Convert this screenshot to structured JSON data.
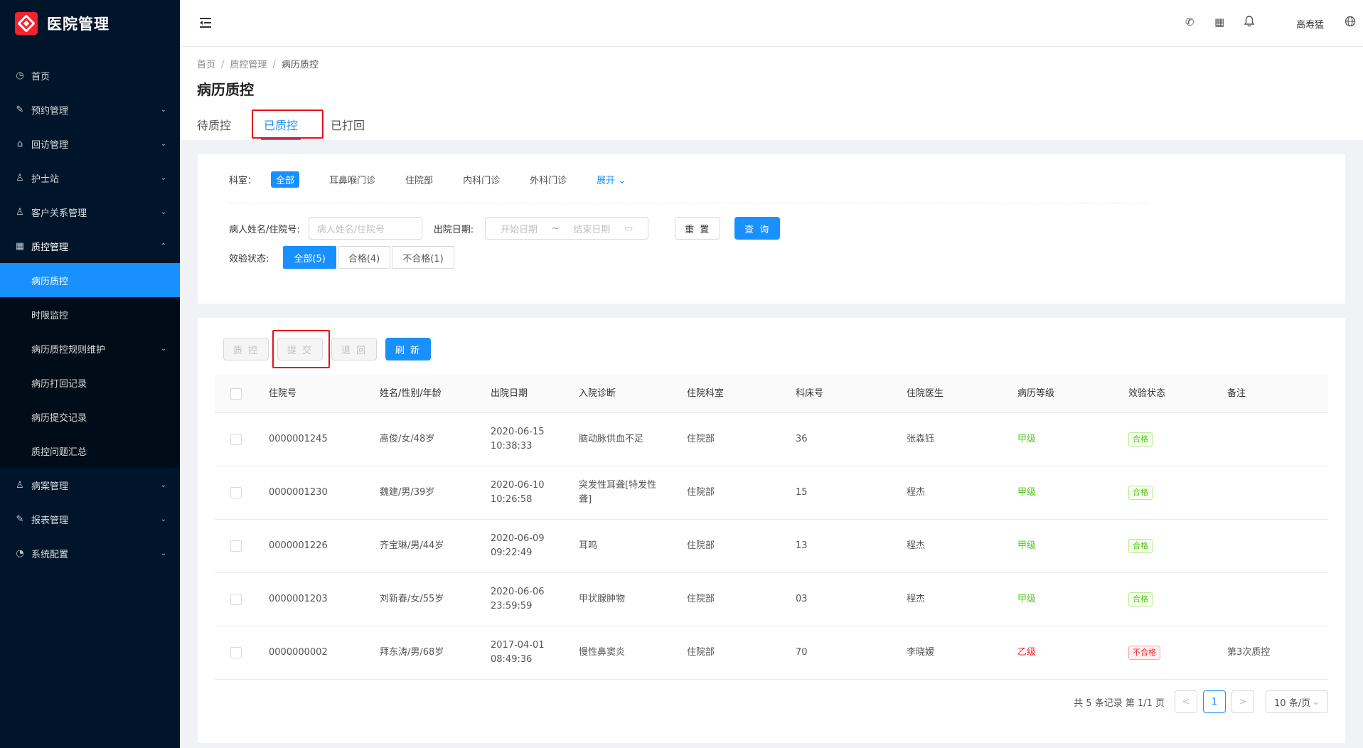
{
  "app": {
    "title": "医院管理"
  },
  "sidebar": {
    "items": [
      {
        "label": "首页",
        "icon": "dashboard-icon"
      },
      {
        "label": "预约管理",
        "icon": "edit-icon"
      },
      {
        "label": "回访管理",
        "icon": "lock-icon"
      },
      {
        "label": "护士站",
        "icon": "user-icon"
      },
      {
        "label": "客户关系管理",
        "icon": "user-icon"
      },
      {
        "label": "质控管理",
        "icon": "table-icon"
      },
      {
        "label": "病案管理",
        "icon": "user-icon"
      },
      {
        "label": "报表管理",
        "icon": "edit-icon"
      },
      {
        "label": "系统配置",
        "icon": "gauge-icon"
      }
    ],
    "sub_items": [
      "病历质控",
      "时限监控",
      "病历质控规则维护",
      "病历打回记录",
      "病历提交记录",
      "质控问题汇总"
    ]
  },
  "header": {
    "user": "高寿猛"
  },
  "breadcrumb": [
    "首页",
    "质控管理",
    "病历质控"
  ],
  "page": {
    "title": "病历质控"
  },
  "tabs": [
    "待质控",
    "已质控",
    "已打回"
  ],
  "filters": {
    "dept_label": "科室：",
    "depts": [
      "全部",
      "耳鼻喉门诊",
      "住院部",
      "内科门诊",
      "外科门诊"
    ],
    "expand": "展开",
    "name_label": "病人姓名/住院号:",
    "name_placeholder": "病人姓名/住院号",
    "date_label": "出院日期:",
    "start_placeholder": "开始日期",
    "date_sep": "~",
    "end_placeholder": "结束日期",
    "reset": "重 置",
    "query": "查 询",
    "status_label": "效验状态:",
    "statuses": [
      "全部(5)",
      "合格(4)",
      "不合格(1)"
    ]
  },
  "toolbar": {
    "qc": "质 控",
    "submit": "提 交",
    "return": "退 回",
    "refresh": "刷 新"
  },
  "table": {
    "columns": [
      "住院号",
      "姓名/性别/年龄",
      "出院日期",
      "入院诊断",
      "住院科室",
      "科床号",
      "住院医生",
      "病历等级",
      "效验状态",
      "备注"
    ],
    "rows": [
      {
        "id": "0000001245",
        "person": "高俊/女/48岁",
        "date": "2020-06-15",
        "time": "10:38:33",
        "diag1": "脑动脉供血不足",
        "diag2": "",
        "dept": "住院部",
        "bed": "36",
        "doctor": "张森钰",
        "grade": "甲级",
        "status": "合格",
        "note": ""
      },
      {
        "id": "0000001230",
        "person": "魏建/男/39岁",
        "date": "2020-06-10",
        "time": "10:26:58",
        "diag1": "突发性耳聋[特发性",
        "diag2": "聋]",
        "dept": "住院部",
        "bed": "15",
        "doctor": "程杰",
        "grade": "甲级",
        "status": "合格",
        "note": ""
      },
      {
        "id": "0000001226",
        "person": "齐宝琳/男/44岁",
        "date": "2020-06-09",
        "time": "09:22:49",
        "diag1": "耳鸣",
        "diag2": "",
        "dept": "住院部",
        "bed": "13",
        "doctor": "程杰",
        "grade": "甲级",
        "status": "合格",
        "note": ""
      },
      {
        "id": "0000001203",
        "person": "刘新春/女/55岁",
        "date": "2020-06-06",
        "time": "23:59:59",
        "diag1": "甲状腺肿物",
        "diag2": "",
        "dept": "住院部",
        "bed": "03",
        "doctor": "程杰",
        "grade": "甲级",
        "status": "合格",
        "note": ""
      },
      {
        "id": "0000000002",
        "person": "拜东涛/男/68岁",
        "date": "2017-04-01",
        "time": "08:49:36",
        "diag1": "慢性鼻窦炎",
        "diag2": "",
        "dept": "住院部",
        "bed": "70",
        "doctor": "李晓嫒",
        "grade": "乙级",
        "status": "不合格",
        "note": "第3次质控"
      }
    ]
  },
  "pagination": {
    "summary": "共 5 条记录 第 1/1 页",
    "prev": "<",
    "current": "1",
    "next": ">",
    "page_size": "10 条/页"
  }
}
